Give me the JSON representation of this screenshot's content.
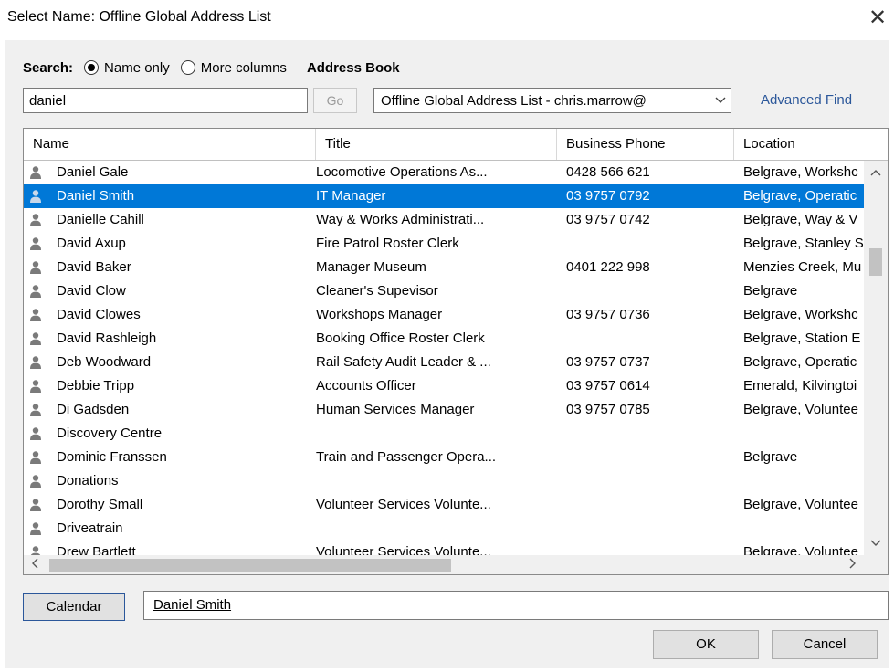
{
  "window": {
    "title": "Select Name: Offline Global Address List",
    "close_glyph": "✕"
  },
  "search": {
    "label": "Search:",
    "option_name_only": "Name only",
    "option_more_columns": "More columns",
    "selected_option": "Name only",
    "value": "daniel",
    "go_label": "Go"
  },
  "address_book": {
    "label": "Address Book",
    "selected": "Offline Global Address List - chris.marrow@",
    "advanced_find": "Advanced Find"
  },
  "list": {
    "columns": [
      "Name",
      "Title",
      "Business Phone",
      "Location"
    ],
    "selected_index": 1,
    "rows": [
      {
        "name": "Daniel Gale",
        "title": "Locomotive Operations As...",
        "phone": "0428 566 621",
        "location": "Belgrave, Workshc"
      },
      {
        "name": "Daniel Smith",
        "title": "IT Manager",
        "phone": "03 9757 0792",
        "location": "Belgrave, Operatic"
      },
      {
        "name": "Danielle Cahill",
        "title": "Way & Works Administrati...",
        "phone": "03 9757 0742",
        "location": "Belgrave, Way & V"
      },
      {
        "name": "David Axup",
        "title": "Fire Patrol Roster Clerk",
        "phone": "",
        "location": "Belgrave, Stanley S"
      },
      {
        "name": "David Baker",
        "title": "Manager Museum",
        "phone": "0401 222 998",
        "location": "Menzies Creek, Mu"
      },
      {
        "name": "David Clow",
        "title": "Cleaner's Supevisor",
        "phone": "",
        "location": "Belgrave"
      },
      {
        "name": "David Clowes",
        "title": "Workshops Manager",
        "phone": "03 9757 0736",
        "location": "Belgrave, Workshc"
      },
      {
        "name": "David Rashleigh",
        "title": "Booking Office Roster Clerk",
        "phone": "",
        "location": "Belgrave, Station E"
      },
      {
        "name": "Deb Woodward",
        "title": "Rail Safety Audit Leader & ...",
        "phone": "03 9757 0737",
        "location": "Belgrave, Operatic"
      },
      {
        "name": "Debbie Tripp",
        "title": "Accounts Officer",
        "phone": "03 9757 0614",
        "location": "Emerald, Kilvingtoi"
      },
      {
        "name": "Di Gadsden",
        "title": "Human Services Manager",
        "phone": "03 9757 0785",
        "location": "Belgrave, Voluntee"
      },
      {
        "name": "Discovery Centre",
        "title": "",
        "phone": "",
        "location": ""
      },
      {
        "name": "Dominic Franssen",
        "title": "Train and Passenger Opera...",
        "phone": "",
        "location": "Belgrave"
      },
      {
        "name": "Donations",
        "title": "",
        "phone": "",
        "location": ""
      },
      {
        "name": "Dorothy Small",
        "title": "Volunteer Services Volunte...",
        "phone": "",
        "location": "Belgrave, Voluntee"
      },
      {
        "name": "Driveatrain",
        "title": "",
        "phone": "",
        "location": ""
      },
      {
        "name": "Drew Bartlett",
        "title": "Volunteer Services Volunte...",
        "phone": "",
        "location": "Belgrave, Voluntee"
      }
    ]
  },
  "calendar": {
    "button_label": "Calendar",
    "value": "Daniel Smith"
  },
  "buttons": {
    "ok": "OK",
    "cancel": "Cancel"
  },
  "icons": {
    "row_icon": "person-icon",
    "close": "close-icon",
    "scroll_up": "chevron-up-icon",
    "scroll_down": "chevron-down-icon",
    "scroll_left": "chevron-left-icon",
    "scroll_right": "chevron-right-icon",
    "dropdown": "chevron-down-icon"
  },
  "colors": {
    "selection": "#0078d7",
    "link": "#2b579a",
    "dialog_bg": "#f0f0f0"
  }
}
